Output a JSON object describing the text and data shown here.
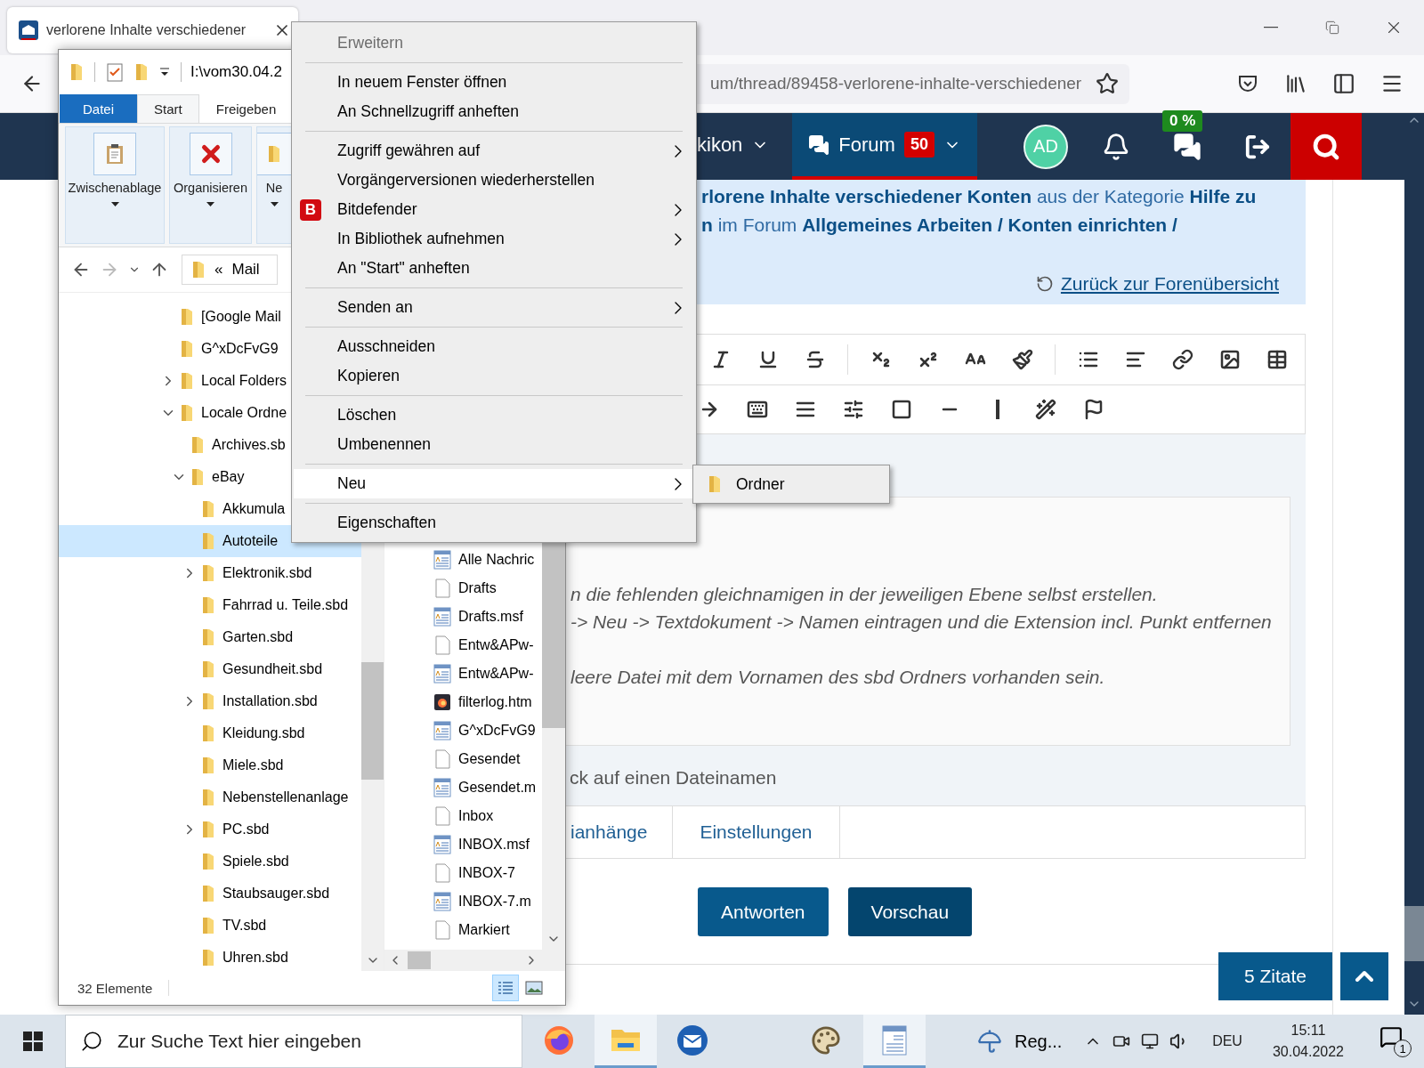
{
  "browser": {
    "tab": {
      "title": "verlorene Inhalte verschiedener"
    },
    "url": "um/thread/89458-verlorene-inhalte-verschiedener",
    "site_nav": {
      "items": [
        {
          "label": "kikon",
          "selected": false
        },
        {
          "label": "Forum",
          "badge": "50",
          "selected": true
        }
      ],
      "avatar": "AD",
      "chat_badge": "0 %"
    },
    "breadcrumb": {
      "lines": [
        "**rlorene Inhalte verschiedener Konten** aus der Kategorie **Hilfe zu**",
        "**n** im Forum **Allgemeines Arbeiten / Konten einrichten /**"
      ],
      "back_link": "Zurück zur Forenübersicht"
    },
    "editor": {
      "paragraphs": [
        [
          "n die fehlenden gleichnamigen in der jeweiligen Ebene selbst erstellen.",
          "-> Neu -> Textdokument -> Namen eintragen und die Extension incl. Punkt entfernen"
        ],
        [
          "leere Datei mit dem Vornamen des sbd Ordners vorhanden sein."
        ]
      ],
      "hint": "ck auf einen Dateinamen",
      "tabs": [
        {
          "label": "ianhänge",
          "selected": false
        },
        {
          "label": "Einstellungen",
          "selected": false
        }
      ],
      "buttons": [
        {
          "label": "Antworten",
          "kind": "primary"
        },
        {
          "label": "Vorschau",
          "kind": "secondary"
        }
      ]
    },
    "quotes_button": "5 Zitate"
  },
  "explorer": {
    "path": "I:\\vom30.04.2",
    "ribbon_tabs": [
      {
        "label": "Datei",
        "kind": "file",
        "selected": false
      },
      {
        "label": "Start",
        "kind": "tab",
        "selected": true
      },
      {
        "label": "Freigeben",
        "kind": "tab",
        "selected": false
      }
    ],
    "ribbon_groups": [
      {
        "label": "Zwischenablage",
        "kind": "clipboard"
      },
      {
        "label": "Organisieren",
        "kind": "delete"
      },
      {
        "label": "Ne",
        "kind": "folder"
      }
    ],
    "address": {
      "prefix": "«",
      "folder": "Mail"
    },
    "tree": [
      {
        "label": "[Google Mail",
        "selected": false
      },
      {
        "label": "G^xDcFvG9",
        "selected": false
      },
      {
        "label": "Local Folders",
        "expanded": false,
        "selected": false
      },
      {
        "label": "Locale Ordne",
        "expanded": true,
        "selected": false,
        "children": [
          {
            "label": "Archives.sb",
            "selected": false
          },
          {
            "label": "eBay",
            "expanded": true,
            "selected": false,
            "children": [
              {
                "label": "Akkumula",
                "selected": false
              },
              {
                "label": "Autoteile",
                "selected": true
              },
              {
                "label": "Elektronik.sbd",
                "expanded": false,
                "selected": false
              },
              {
                "label": "Fahrrad u. Teile.sbd",
                "selected": false
              },
              {
                "label": "Garten.sbd",
                "selected": false
              },
              {
                "label": "Gesundheit.sbd",
                "selected": false
              },
              {
                "label": "Installation.sbd",
                "expanded": false,
                "selected": false
              },
              {
                "label": "Kleidung.sbd",
                "selected": false
              },
              {
                "label": "Miele.sbd",
                "selected": false
              },
              {
                "label": "Nebenstellenanlage",
                "selected": false
              },
              {
                "label": "PC.sbd",
                "expanded": false,
                "selected": false
              },
              {
                "label": "Spiele.sbd",
                "selected": false
              },
              {
                "label": "Staubsauger.sbd",
                "selected": false
              },
              {
                "label": "TV.sbd",
                "selected": false
              },
              {
                "label": "Uhren.sbd",
                "selected": false
              }
            ]
          }
        ]
      }
    ],
    "files": [
      {
        "name": "Alle Nachric",
        "kind": "index"
      },
      {
        "name": "Drafts",
        "kind": "blank"
      },
      {
        "name": "Drafts.msf",
        "kind": "index"
      },
      {
        "name": "Entw&APw-",
        "kind": "blank"
      },
      {
        "name": "Entw&APw-",
        "kind": "index"
      },
      {
        "name": "filterlog.htm",
        "kind": "html"
      },
      {
        "name": "G^xDcFvG9",
        "kind": "index"
      },
      {
        "name": "Gesendet",
        "kind": "blank"
      },
      {
        "name": "Gesendet.m",
        "kind": "index"
      },
      {
        "name": "Inbox",
        "kind": "blank"
      },
      {
        "name": "INBOX.msf",
        "kind": "index"
      },
      {
        "name": "INBOX-7",
        "kind": "blank"
      },
      {
        "name": "INBOX-7.m",
        "kind": "index"
      },
      {
        "name": "Markiert",
        "kind": "blank"
      }
    ],
    "status": "32 Elemente",
    "views": [
      {
        "kind": "details",
        "selected": true
      },
      {
        "kind": "thumbnails",
        "selected": false
      }
    ]
  },
  "context_menu": {
    "groups": [
      [
        {
          "label": "Erweitern",
          "disabled": true,
          "submenu": false,
          "selected": false
        }
      ],
      [
        {
          "label": "In neuem Fenster öffnen",
          "disabled": false,
          "submenu": false,
          "selected": false
        },
        {
          "label": "An Schnellzugriff anheften",
          "disabled": false,
          "submenu": false,
          "selected": false
        }
      ],
      [
        {
          "label": "Zugriff gewähren auf",
          "disabled": false,
          "submenu": true,
          "selected": false
        },
        {
          "label": "Vorgängerversionen wiederherstellen",
          "disabled": false,
          "submenu": false,
          "selected": false
        },
        {
          "label": "Bitdefender",
          "badge": "B",
          "disabled": false,
          "submenu": true,
          "selected": false
        },
        {
          "label": "In Bibliothek aufnehmen",
          "disabled": false,
          "submenu": true,
          "selected": false
        },
        {
          "label": "An \"Start\" anheften",
          "disabled": false,
          "submenu": false,
          "selected": false
        }
      ],
      [
        {
          "label": "Senden an",
          "disabled": false,
          "submenu": true,
          "selected": false
        }
      ],
      [
        {
          "label": "Ausschneiden",
          "disabled": false,
          "submenu": false,
          "selected": false
        },
        {
          "label": "Kopieren",
          "disabled": false,
          "submenu": false,
          "selected": false
        }
      ],
      [
        {
          "label": "Löschen",
          "disabled": false,
          "submenu": false,
          "selected": false
        },
        {
          "label": "Umbenennen",
          "disabled": false,
          "submenu": false,
          "selected": false
        }
      ],
      [
        {
          "label": "Neu",
          "disabled": false,
          "submenu": true,
          "selected": true
        }
      ],
      [
        {
          "label": "Eigenschaften",
          "disabled": false,
          "submenu": false,
          "selected": false
        }
      ]
    ],
    "submenu": {
      "items": [
        {
          "label": "Ordner"
        }
      ]
    }
  },
  "taskbar": {
    "search_placeholder": "Zur Suche Text hier eingeben",
    "apps": [
      {
        "kind": "firefox",
        "active": false
      },
      {
        "kind": "explorer",
        "active": true
      },
      {
        "kind": "thunderbird",
        "active": false
      },
      {
        "kind": "paint",
        "active": false
      },
      {
        "kind": "document",
        "active": true
      }
    ],
    "pinned_label": "Reg...",
    "language": "DEU",
    "time": "15:11",
    "date": "30.04.2022",
    "notifications": "1"
  }
}
